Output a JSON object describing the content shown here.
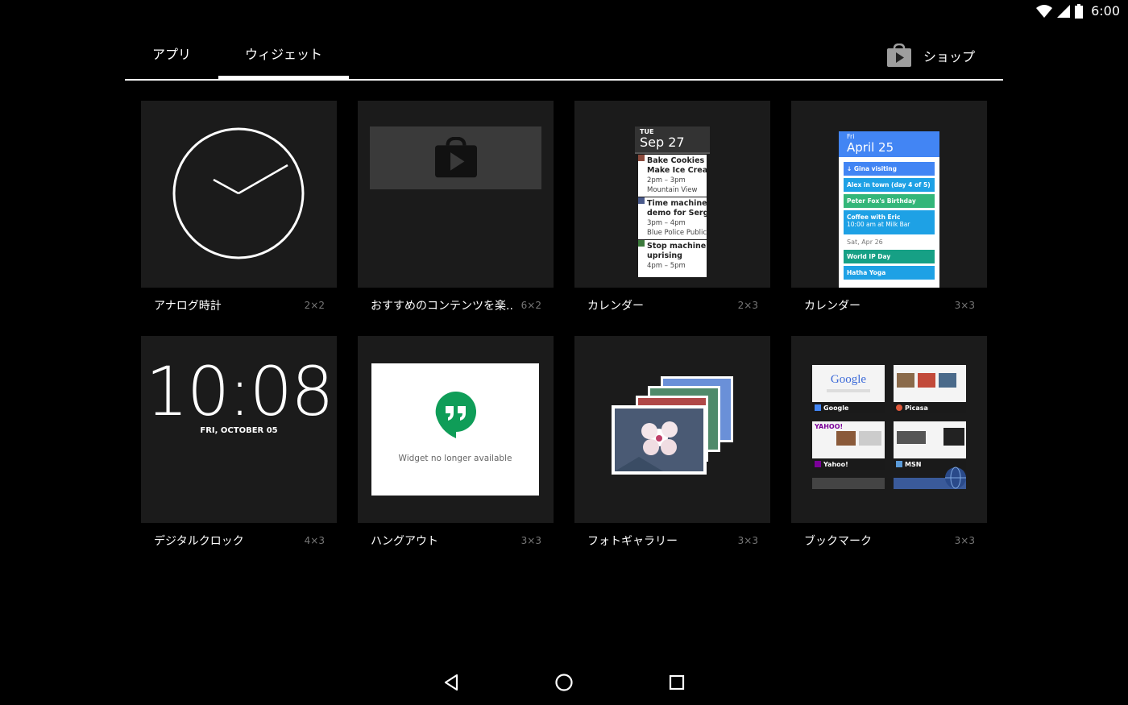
{
  "status": {
    "time": "6:00",
    "icons": [
      "wifi-icon",
      "signal-icon",
      "battery-icon"
    ]
  },
  "tabs": [
    {
      "label": "アプリ",
      "selected": false
    },
    {
      "label": "ウィジェット",
      "selected": true
    }
  ],
  "shop": {
    "label": "ショップ",
    "icon": "play-store-icon"
  },
  "widgets": [
    {
      "title": "アナログ時計",
      "size": "2×2"
    },
    {
      "title": "おすすめのコンテンツを楽..",
      "size": "6×2"
    },
    {
      "title": "カレンダー",
      "size": "2×3"
    },
    {
      "title": "カレンダー",
      "size": "3×3"
    },
    {
      "title": "デジタルクロック",
      "size": "4×3"
    },
    {
      "title": "ハングアウト",
      "size": "3×3"
    },
    {
      "title": "フォトギャラリー",
      "size": "3×3"
    },
    {
      "title": "ブックマーク",
      "size": "3×3"
    }
  ],
  "digital_clock": {
    "time": "10:08",
    "date": "FRI, OCTOBER 05"
  },
  "calendar_small": {
    "dow": "TUE",
    "date": "Sep 27",
    "events": [
      {
        "title1": "Bake Cookies &",
        "title2": "Make Ice Cream",
        "time": "2pm – 3pm",
        "place": "Mountain View",
        "color": "#8b4a3c"
      },
      {
        "title1": "Time machine",
        "title2": "demo for Sergey",
        "time": "3pm – 4pm",
        "place": "Blue Police Public",
        "color": "#4a5a8b"
      },
      {
        "title1": "Stop machine",
        "title2": "uprising",
        "time": "4pm – 5pm",
        "place": "",
        "color": "#3c7a3c"
      }
    ]
  },
  "calendar_large": {
    "dow": "Fri",
    "date": "April 25",
    "events": [
      {
        "text": "Gina visiting",
        "line2": "",
        "color": "#4285f4"
      },
      {
        "text": "Alex in town (day 4 of 5)",
        "line2": "",
        "color": "#1ea1e5"
      },
      {
        "text": "Peter Fox's Birthday",
        "line2": "",
        "color": "#33b679"
      },
      {
        "text": "Coffee with Eric",
        "line2": "10:00 am at Milk Bar",
        "color": "#1ea1e5"
      }
    ],
    "separator": "Sat, Apr 26",
    "events2": [
      {
        "text": "World IP Day",
        "line2": "",
        "color": "#16a085"
      },
      {
        "text": "Hatha Yoga",
        "line2": "",
        "color": "#1ea1e5"
      }
    ]
  },
  "hangouts": {
    "message": "Widget no longer available",
    "brand_color": "#0f9d58"
  },
  "bookmarks": [
    {
      "label": "Google",
      "logo": "Google"
    },
    {
      "label": "Picasa",
      "logo": ""
    },
    {
      "label": "Yahoo!",
      "logo": "YAHOO!"
    },
    {
      "label": "MSN",
      "logo": ""
    }
  ],
  "nav": {
    "icons": [
      "back-icon",
      "home-icon",
      "recents-icon"
    ]
  }
}
